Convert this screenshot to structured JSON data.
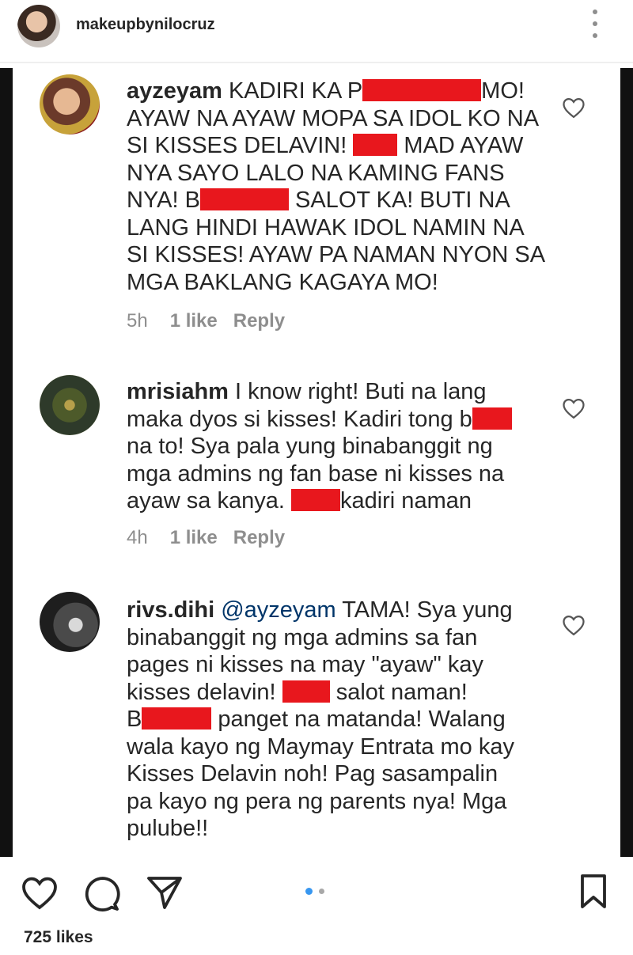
{
  "header": {
    "username": "makeupbynilocruz"
  },
  "comments": [
    {
      "username": "ayzeyam",
      "lines": [
        [
          "KADIRI KA P",
          "[R]",
          "MO!"
        ],
        [
          "AYAW NA AYAW MOPA SA IDOL KO NA"
        ],
        [
          "SI KISSES DELAVIN! ",
          "[R]",
          "MAD AYAW"
        ],
        [
          "NYA SAYO LALO NA KAMING FANS"
        ],
        [
          "NYA! B",
          "[R]",
          "SALOT KA! BUTI NA"
        ],
        [
          "LANG HINDI HAWAK IDOL NAMIN NA"
        ],
        [
          "SI KISSES! AYAW PA NAMAN NYON SA"
        ],
        [
          "MGA BAKLANG KAGAYA MO!"
        ]
      ],
      "time": "5h",
      "likes": "1 like",
      "reply": "Reply"
    },
    {
      "username": "mrisiahm",
      "lines": [
        [
          "I know right! Buti na lang"
        ],
        [
          "maka dyos si kisses! Kadiri tong b",
          "[R]"
        ],
        [
          "na to! Sya pala yung binabanggit ng"
        ],
        [
          "mga admins ng fan base ni kisses na"
        ],
        [
          "ayaw sa kanya. ",
          "[R]",
          "kadiri naman"
        ]
      ],
      "time": "4h",
      "likes": "1 like",
      "reply": "Reply"
    },
    {
      "username": "rivs.dihi",
      "lines": [
        [
          "@ayzeyam TAMA! Sya yung"
        ],
        [
          "binabanggit ng mga admins sa fan"
        ],
        [
          "pages ni kisses na may \"ayaw\" kay"
        ],
        [
          "kisses delavin! ",
          "[R]",
          " salot naman!"
        ],
        [
          "B",
          "[R]",
          " panget na matanda! Walang"
        ],
        [
          "wala kayo ng Maymay Entrata mo kay"
        ],
        [
          "Kisses Delavin noh! Pag sasampalin"
        ],
        [
          "pa kayo ng pera ng parents nya! Mga"
        ],
        [
          "pulube!!"
        ]
      ]
    }
  ],
  "post": {
    "likes_count": "725 likes"
  },
  "colors": {
    "redaction": "#e8171d",
    "mention": "#003569",
    "carousel_active": "#3897f0"
  }
}
